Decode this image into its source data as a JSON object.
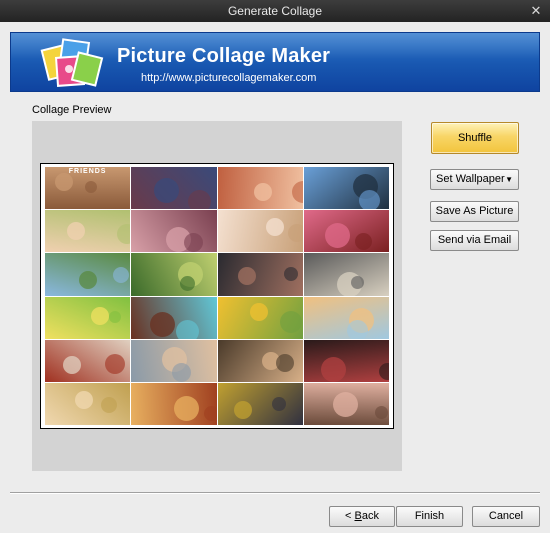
{
  "window": {
    "title": "Generate Collage",
    "close_glyph": "✕"
  },
  "banner": {
    "app_name": "Picture Collage Maker",
    "url": "http://www.picturecollagemaker.com",
    "logo_icon": "photo-collage-logo-icon",
    "colors": {
      "top": "#2f78cc",
      "bottom": "#0f43a0"
    }
  },
  "preview": {
    "label": "Collage Preview",
    "tile_overlay_text": "FRIENDS",
    "photo_count": 24,
    "photo_tones": [
      [
        "#8a5a3a",
        "#c89870"
      ],
      [
        "#6a3a4a",
        "#3a4a7a"
      ],
      [
        "#c06040",
        "#f0c0a0"
      ],
      [
        "#6aa0d8",
        "#203040"
      ],
      [
        "#b0c070",
        "#f0d0b0"
      ],
      [
        "#7a4050",
        "#d8a0a8"
      ],
      [
        "#c8a078",
        "#f4e0d0"
      ],
      [
        "#7a2020",
        "#e06a8a"
      ],
      [
        "#8ab8e0",
        "#5a8a40"
      ],
      [
        "#3a6a2a",
        "#c0d070"
      ],
      [
        "#2a2a30",
        "#a07060"
      ],
      [
        "#5a5a5a",
        "#d8d0c0"
      ],
      [
        "#80c040",
        "#f0e060"
      ],
      [
        "#60c8d8",
        "#6a3020"
      ],
      [
        "#70a040",
        "#f0c030"
      ],
      [
        "#a0c8e0",
        "#f0c080"
      ],
      [
        "#a03020",
        "#e0d0c0"
      ],
      [
        "#8a9aa8",
        "#e0c0a0"
      ],
      [
        "#4a3a2a",
        "#d8b088"
      ],
      [
        "#2a1a1a",
        "#b04040"
      ],
      [
        "#c0a050",
        "#f0d8b0"
      ],
      [
        "#a04020",
        "#e8b060"
      ],
      [
        "#303040",
        "#c0a030"
      ],
      [
        "#6a4a3a",
        "#e0b0a0"
      ]
    ]
  },
  "actions": {
    "shuffle": "Shuffle",
    "set_wallpaper": "Set Wallpaper",
    "set_wallpaper_arrow": "▼",
    "save_as_picture": "Save As Picture",
    "send_via_email": "Send via Email"
  },
  "footer": {
    "back_prefix": "< ",
    "back_mnemonic": "B",
    "back_rest": "ack",
    "finish": "Finish",
    "cancel": "Cancel"
  }
}
